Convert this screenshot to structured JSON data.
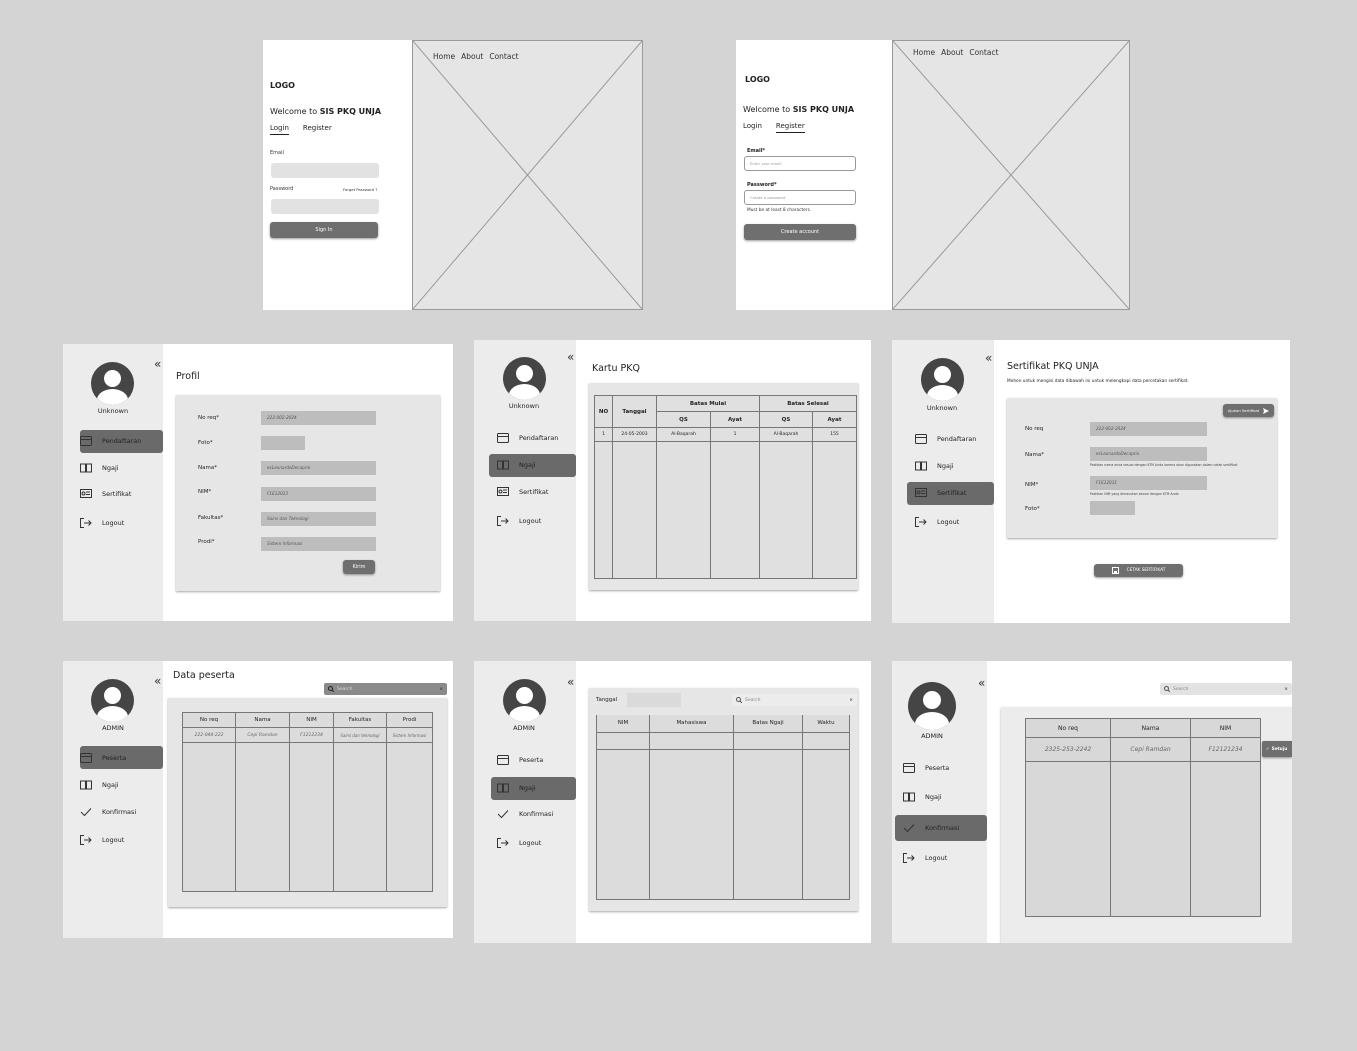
{
  "login": {
    "logo": "LOGO",
    "welcome_prefix": "Welcome to ",
    "welcome_brand": "SIS PKQ UNJA",
    "tab_login": "Login",
    "tab_register": "Register",
    "email_label": "Email",
    "password_label": "Password",
    "forgot": "Forget Password ?",
    "sign_in": "Sign In",
    "nav": [
      "Home",
      "About",
      "Contact"
    ]
  },
  "register": {
    "logo": "LOGO",
    "welcome_prefix": "Welcome to ",
    "welcome_brand": "SIS PKQ UNJA",
    "tab_login": "Login",
    "tab_register": "Register",
    "email_label": "Email*",
    "email_placeholder": "Enter your email",
    "password_label": "Password*",
    "password_placeholder": "Create a password",
    "hint": "Must be at least 8 characters.",
    "create": "Create account",
    "nav": [
      "Home",
      "About",
      "Contact"
    ]
  },
  "user_sidebar": {
    "name": "Unknown",
    "items": [
      "Pendaftaran",
      "Ngaji",
      "Sertifikat",
      "Logout"
    ]
  },
  "admin_sidebar": {
    "name": "ADMIN",
    "items": [
      "Peserta",
      "Ngaji",
      "Konfirmasi",
      "Logout"
    ]
  },
  "profil": {
    "title": "Profil",
    "labels": [
      "No req*",
      "Foto*",
      "Nama*",
      "NIM*",
      "Fakultas*",
      "Prodi*"
    ],
    "values": [
      "222-002-2024",
      "",
      "ecLeonardoDecaprio",
      "F1E12023",
      "Sains dan Teknologi",
      "Sistem Informasi"
    ],
    "submit": "Kirim"
  },
  "kartu": {
    "title": "Kartu PKQ",
    "headers": {
      "no": "NO",
      "tanggal": "Tanggal",
      "mulai": "Batas Mulai",
      "selesai": "Batas Selesai",
      "qs": "QS",
      "ayat": "Ayat"
    },
    "row": [
      "1",
      "24-05-2003",
      "Al-Baqarah",
      "1",
      "Al-Baqarah",
      "155"
    ]
  },
  "sertifikat": {
    "title": "Sertifikat PKQ UNJA",
    "subtitle": "Mohon untuk mengisi data dibawah ini untuk melengkapi data percetakan sertifikat.",
    "ajukan": "Ajukan Sertifikat",
    "labels": [
      "No req",
      "Nama*",
      "NIM*",
      "Foto*"
    ],
    "values": [
      "222-002-2024",
      "ecLeonardoDecaprio",
      "F1E12031"
    ],
    "note_nama": "Pastikan nama anda sesuai dengan KTM Anda karena akan digunakan dalam cetak sertifikat",
    "note_nim": "Pastikan NIM yang dimasukan sesuai dengan KTM Anda",
    "cetak": "CETAK SERTIFIKAT"
  },
  "peserta": {
    "title": "Data peserta",
    "search": "Search",
    "headers": [
      "No req",
      "Nama",
      "NIM",
      "Fakultas",
      "Prodi"
    ],
    "row": [
      "222-044-222",
      "Cepi Ramdan",
      "F1212234",
      "Sains dan teknologi",
      "Sistem Informasi"
    ]
  },
  "ngaji_admin": {
    "tanggal": "Tanggal",
    "search": "Search",
    "headers": [
      "NIM",
      "Mahasiswa",
      "Batas Ngaji",
      "Waktu"
    ]
  },
  "konfirmasi": {
    "search": "Search",
    "headers": [
      "No req",
      "Nama",
      "NIM"
    ],
    "row": [
      "2325-253-2242",
      "Cepi Ramdan",
      "F12121234"
    ],
    "setuju": "Setuju"
  }
}
